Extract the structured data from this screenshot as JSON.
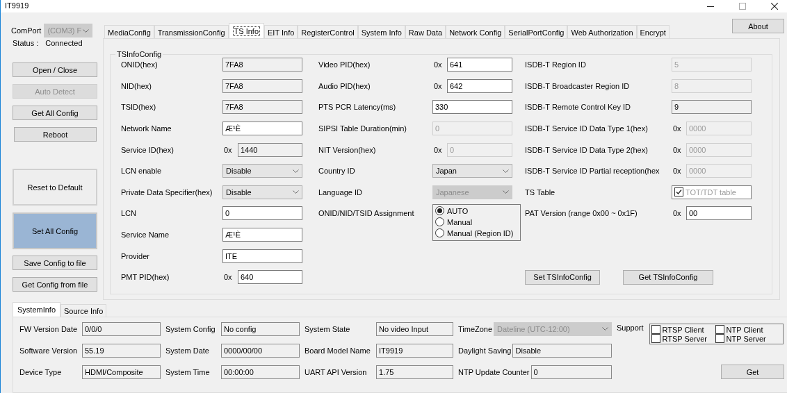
{
  "window": {
    "title": "IT9919"
  },
  "com_port": {
    "label": "ComPort",
    "value": "(COM3) F",
    "disabled": true
  },
  "status": {
    "label": "Status :",
    "value": "Connected"
  },
  "side_buttons": [
    {
      "label": "Open / Close",
      "kind": "small",
      "disabled": false,
      "highlighted": false
    },
    {
      "label": "Auto Detect",
      "kind": "small",
      "disabled": true,
      "highlighted": false
    },
    {
      "label": "Get All Config",
      "kind": "small",
      "disabled": false,
      "highlighted": false
    },
    {
      "label": "Reboot",
      "kind": "small",
      "disabled": false,
      "highlighted": false
    },
    {
      "label": "Reset to Default",
      "kind": "large",
      "disabled": false,
      "highlighted": false
    },
    {
      "label": "Set All Config",
      "kind": "large",
      "disabled": false,
      "highlighted": true
    },
    {
      "label": "Save Config to file",
      "kind": "small",
      "disabled": false,
      "highlighted": false
    },
    {
      "label": "Get Config from file",
      "kind": "small",
      "disabled": false,
      "highlighted": false
    }
  ],
  "tabs": [
    {
      "label": "MediaConfig",
      "selected": false
    },
    {
      "label": "TransmissionConfig",
      "selected": false
    },
    {
      "label": "TS Info",
      "selected": true
    },
    {
      "label": "EIT Info",
      "selected": false
    },
    {
      "label": "RegisterControl",
      "selected": false
    },
    {
      "label": "System Info",
      "selected": false
    },
    {
      "label": "Raw Data",
      "selected": false
    },
    {
      "label": "Network Config",
      "selected": false
    },
    {
      "label": "SerialPortConfig",
      "selected": false
    },
    {
      "label": "Web Authorization",
      "selected": false
    },
    {
      "label": "Encrypt",
      "selected": false
    }
  ],
  "about_button": "About",
  "ts_info": {
    "group_title": "TSInfoConfig",
    "columns": [
      [
        {
          "label": "ONID(hex)",
          "kind": "text",
          "value": "7FA8",
          "readonly": true,
          "disabled": false
        },
        {
          "label": "NID(hex)",
          "kind": "text",
          "value": "7FA8",
          "readonly": true,
          "disabled": false
        },
        {
          "label": "TSID(hex)",
          "kind": "text",
          "value": "7FA8",
          "readonly": true,
          "disabled": false
        },
        {
          "label": "Network Name",
          "kind": "text",
          "value": "Æ¹È",
          "readonly": false,
          "disabled": false
        },
        {
          "label": "Service ID(hex)",
          "kind": "text",
          "prefix": "0x",
          "value": "1440",
          "readonly": true,
          "disabled": false
        },
        {
          "label": "LCN enable",
          "kind": "select",
          "value": "Disable",
          "disabled": false
        },
        {
          "label": "Private Data Specifier(hex)",
          "kind": "select",
          "value": "Disable",
          "disabled": false
        },
        {
          "label": "LCN",
          "kind": "text",
          "value": "0",
          "readonly": false,
          "disabled": false
        },
        {
          "label": "Service Name",
          "kind": "text",
          "value": "Æ¹È",
          "readonly": false,
          "disabled": false
        },
        {
          "label": "Provider",
          "kind": "text",
          "value": "ITE",
          "readonly": false,
          "disabled": false
        },
        {
          "label": "PMT PID(hex)",
          "kind": "text",
          "prefix": "0x",
          "value": "640",
          "readonly": false,
          "disabled": false
        }
      ],
      [
        {
          "label": "Video PID(hex)",
          "kind": "text",
          "prefix": "0x",
          "value": "641",
          "readonly": false,
          "disabled": false
        },
        {
          "label": "Audio PID(hex)",
          "kind": "text",
          "prefix": "0x",
          "value": "642",
          "readonly": false,
          "disabled": false
        },
        {
          "label": "PTS PCR Latency(ms)",
          "kind": "text",
          "value": "330",
          "readonly": false,
          "disabled": false
        },
        {
          "label": "SIPSI Table Duration(min)",
          "kind": "text",
          "value": "0",
          "readonly": false,
          "disabled": true
        },
        {
          "label": "NIT Version(hex)",
          "kind": "text",
          "prefix": "0x",
          "value": "0",
          "readonly": false,
          "disabled": true
        },
        {
          "label": "Country ID",
          "kind": "select",
          "value": "Japan",
          "disabled": false
        },
        {
          "label": "Language ID",
          "kind": "select",
          "value": "Japanese",
          "disabled": true
        },
        {
          "label": "ONID/NID/TSID Assignment",
          "kind": "radio",
          "options": [
            {
              "label": "AUTO",
              "selected": true
            },
            {
              "label": "Manual",
              "selected": false
            },
            {
              "label": "Manual (Region ID)",
              "selected": false
            }
          ]
        }
      ],
      [
        {
          "label": "ISDB-T Region ID",
          "kind": "text",
          "value": "5",
          "readonly": false,
          "disabled": true
        },
        {
          "label": "ISDB-T Broadcaster Region ID",
          "kind": "text",
          "value": "8",
          "readonly": false,
          "disabled": true
        },
        {
          "label": "ISDB-T Remote Control Key ID",
          "kind": "text",
          "value": "9",
          "readonly": true,
          "disabled": false
        },
        {
          "label": "ISDB-T Service ID Data Type 1(hex)",
          "kind": "text",
          "prefix": "0x",
          "value": "0000",
          "readonly": false,
          "disabled": true
        },
        {
          "label": "ISDB-T Service ID Data Type 2(hex)",
          "kind": "text",
          "prefix": "0x",
          "value": "0000",
          "readonly": false,
          "disabled": true
        },
        {
          "label": "ISDB-T Service ID Partial reception(hex",
          "kind": "text",
          "prefix": "0x",
          "value": "0000",
          "readonly": false,
          "disabled": true
        },
        {
          "label": "TS Table",
          "kind": "checkbox",
          "text": "TOT/TDT table",
          "checked": true,
          "disabled": true
        },
        {
          "label": "PAT Version (range 0x00 ~ 0x1F)",
          "kind": "text",
          "prefix": "0x",
          "value": "00",
          "readonly": false,
          "disabled": false
        }
      ]
    ],
    "buttons": [
      "Set TSInfoConfig",
      "Get TSInfoConfig"
    ]
  },
  "system_info": {
    "tabs": [
      {
        "label": "SystemInfo",
        "selected": true
      },
      {
        "label": "Source Info",
        "selected": false
      }
    ],
    "rows": [
      [
        {
          "label": "FW Version Date",
          "kind": "text",
          "value": "0/0/0"
        },
        {
          "label": "System Config",
          "kind": "text",
          "value": "No config"
        },
        {
          "label": "System State",
          "kind": "text",
          "value": "No video Input"
        },
        {
          "label": "TimeZone",
          "kind": "select",
          "value": "Dateline (UTC-12:00)",
          "disabled": true
        }
      ],
      [
        {
          "label": "Software Version",
          "kind": "text",
          "value": "55.19"
        },
        {
          "label": "System Date",
          "kind": "text",
          "value": "0000/00/00"
        },
        {
          "label": "Board Model Name",
          "kind": "text",
          "value": "IT9919"
        },
        {
          "label": "Daylight Saving",
          "kind": "text",
          "value": "Disable"
        }
      ],
      [
        {
          "label": "Device Type",
          "kind": "text",
          "value": "HDMI/Composite"
        },
        {
          "label": "System Time",
          "kind": "text",
          "value": "00:00:00"
        },
        {
          "label": "UART API Version",
          "kind": "text",
          "value": "1.75"
        },
        {
          "label": "NTP Update Counter",
          "kind": "text",
          "value": "0"
        }
      ]
    ],
    "support": {
      "label": "Support",
      "options": [
        {
          "label": "RTSP Client",
          "checked": false
        },
        {
          "label": "NTP Client",
          "checked": false
        },
        {
          "label": "RTSP Server",
          "checked": false
        },
        {
          "label": "NTP Server",
          "checked": false
        }
      ]
    },
    "get_button": "Get"
  }
}
